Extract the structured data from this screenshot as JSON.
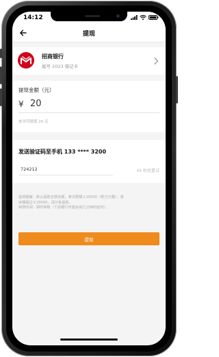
{
  "status": {
    "time": "14:12"
  },
  "nav": {
    "title": "提现"
  },
  "bank": {
    "name": "招商银行",
    "account": "尾号 2023 借记卡"
  },
  "amount": {
    "label": "提现金额（元）",
    "currency": "¥",
    "value": "20",
    "hint": "本次可提现 20 元"
  },
  "code": {
    "title": "发送验证码至手机 133 **** 3200",
    "value": "724212",
    "resend": "44 秒后重试"
  },
  "notes": {
    "line1": "提现额度：默认提取全部余额，单次限额￥20000（贰万元整），若",
    "line2": "余额超过￥20000，请分批提现。",
    "line3": "到账时间：即时到账（个别银行可能会有几分钟的延时）。"
  },
  "submit": {
    "label": "提现"
  },
  "colors": {
    "accent": "#ef8a1d",
    "bank_red": "#d0001b"
  },
  "icons": [
    "back-arrow-icon",
    "signal-icon",
    "wifi-icon",
    "battery-icon",
    "bank-logo-icon",
    "chevron-right-icon"
  ]
}
